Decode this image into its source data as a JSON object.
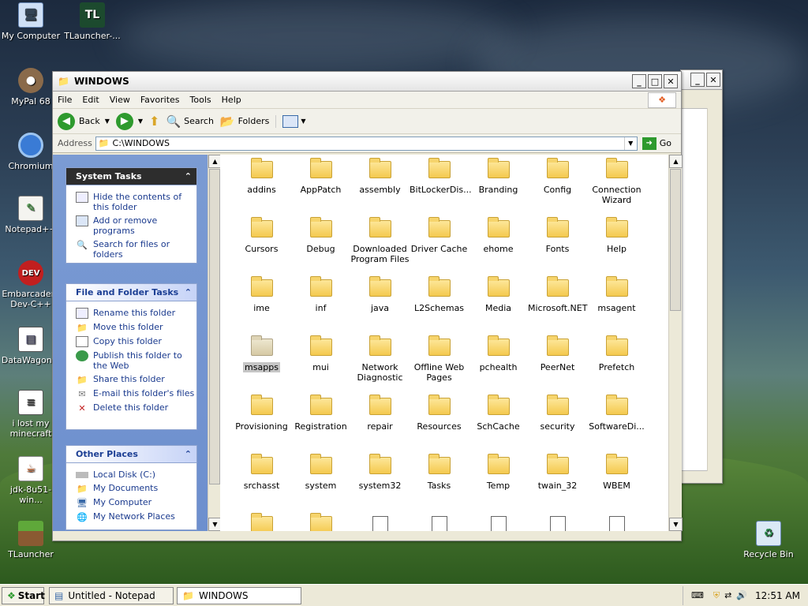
{
  "desktop": {
    "icons": [
      {
        "label": "My Computer"
      },
      {
        "label": "TLauncher-..."
      },
      {
        "label": "MyPal 68"
      },
      {
        "label": "Chromium"
      },
      {
        "label": "Notepad++"
      },
      {
        "label": "Embarcadero Dev-C++"
      },
      {
        "label": "DataWagon..."
      },
      {
        "label": "i lost my minecraft"
      },
      {
        "label": "jdk-8u51-win..."
      },
      {
        "label": "TLauncher"
      },
      {
        "label": "Recycle Bin"
      }
    ]
  },
  "window": {
    "title": "WINDOWS"
  },
  "menu": [
    "File",
    "Edit",
    "View",
    "Favorites",
    "Tools",
    "Help"
  ],
  "toolbar": {
    "back": "Back",
    "search": "Search",
    "folders": "Folders"
  },
  "address": {
    "label": "Address",
    "value": "C:\\WINDOWS",
    "go": "Go"
  },
  "panels": {
    "system": {
      "title": "System Tasks",
      "items": [
        "Hide the contents of this folder",
        "Add or remove programs",
        "Search for files or folders"
      ]
    },
    "file": {
      "title": "File and Folder Tasks",
      "items": [
        "Rename this folder",
        "Move this folder",
        "Copy this folder",
        "Publish this folder to the Web",
        "Share this folder",
        "E-mail this folder's files",
        "Delete this folder"
      ]
    },
    "other": {
      "title": "Other Places",
      "items": [
        "Local Disk (C:)",
        "My Documents",
        "My Computer",
        "My Network Places"
      ]
    }
  },
  "files": [
    "addins",
    "AppPatch",
    "assembly",
    "BitLockerDis...",
    "Branding",
    "Config",
    "Connection Wizard",
    "Cursors",
    "Debug",
    "Downloaded Program Files",
    "Driver Cache",
    "ehome",
    "Fonts",
    "Help",
    "ime",
    "inf",
    "java",
    "L2Schemas",
    "Media",
    "Microsoft.NET",
    "msagent",
    "msapps",
    "mui",
    "Network Diagnostic",
    "Offline Web Pages",
    "pchealth",
    "PeerNet",
    "Prefetch",
    "Provisioning",
    "Registration",
    "repair",
    "Resources",
    "SchCache",
    "security",
    "SoftwareDi...",
    "srchasst",
    "system",
    "system32",
    "Tasks",
    "Temp",
    "twain_32",
    "WBEM"
  ],
  "taskbar": {
    "start": "Start",
    "tasks": [
      "Untitled - Notepad",
      "WINDOWS"
    ],
    "clock": "12:51 AM"
  }
}
